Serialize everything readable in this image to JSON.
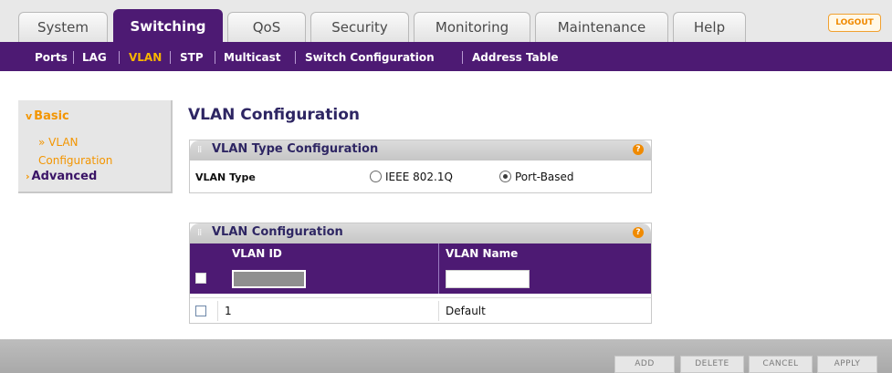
{
  "top_tabs": [
    "System",
    "Switching",
    "QoS",
    "Security",
    "Monitoring",
    "Maintenance",
    "Help"
  ],
  "active_tab": "Switching",
  "logout_label": "LOGOUT",
  "sub_nav": [
    "Ports",
    "LAG",
    "VLAN",
    "STP",
    "Multicast",
    "Switch Configuration",
    "Address Table"
  ],
  "active_sub_nav": "VLAN",
  "sidebar": {
    "basic_label": "Basic",
    "basic_item_line1": "VLAN",
    "basic_item_line2": "Configuration",
    "advanced_label": "Advanced",
    "expanded_mark": "v",
    "collapsed_mark": "›",
    "item_mark": "»"
  },
  "page_title": "VLAN Configuration",
  "help_glyph": "?",
  "type_panel": {
    "title": "VLAN Type Configuration",
    "vlan_type_label": "VLAN Type",
    "options": [
      "IEEE 802.1Q",
      "Port-Based"
    ],
    "selected": "Port-Based"
  },
  "config_panel": {
    "title": "VLAN Configuration",
    "columns": [
      "VLAN ID",
      "VLAN Name"
    ],
    "new_entry": {
      "vlan_id": "",
      "vlan_name": ""
    },
    "rows": [
      {
        "vlan_id": "1",
        "vlan_name": "Default"
      }
    ]
  },
  "footer_buttons": [
    "ADD",
    "DELETE",
    "CANCEL",
    "APPLY"
  ],
  "colors": {
    "brand_purple": "#4d1a73",
    "accent_orange": "#f39500"
  }
}
